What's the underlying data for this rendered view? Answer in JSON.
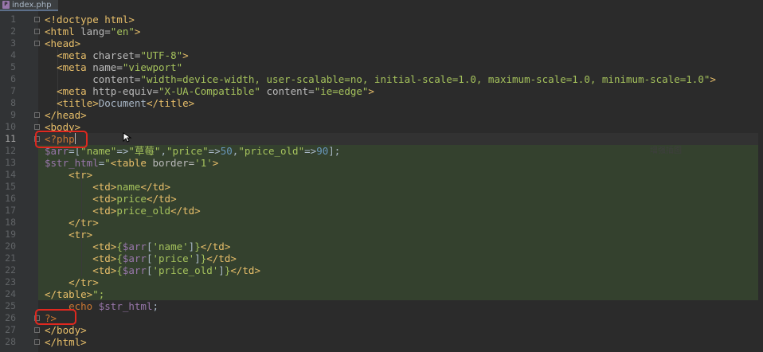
{
  "tab": {
    "file_icon": "php-file-icon",
    "title": "index.php"
  },
  "lines": [
    [
      [
        "tag",
        "<!doctype html>"
      ]
    ],
    [
      [
        "tag",
        "<html "
      ],
      [
        "attr",
        "lang="
      ],
      [
        "str",
        "\"en\""
      ],
      [
        "tag",
        ">"
      ]
    ],
    [
      [
        "tag",
        "<head>"
      ]
    ],
    [
      [
        "txt",
        "  "
      ],
      [
        "tag",
        "<meta "
      ],
      [
        "attr",
        "charset="
      ],
      [
        "str",
        "\"UTF-8\""
      ],
      [
        "tag",
        ">"
      ]
    ],
    [
      [
        "txt",
        "  "
      ],
      [
        "tag",
        "<meta "
      ],
      [
        "attr",
        "name="
      ],
      [
        "str",
        "\"viewport\""
      ]
    ],
    [
      [
        "txt",
        "        "
      ],
      [
        "attr",
        "content="
      ],
      [
        "str",
        "\"width=device-width, user-scalable=no, initial-scale=1.0, maximum-scale=1.0, minimum-scale=1.0\""
      ],
      [
        "tag",
        ">"
      ]
    ],
    [
      [
        "txt",
        "  "
      ],
      [
        "tag",
        "<meta "
      ],
      [
        "attr",
        "http-equiv="
      ],
      [
        "str",
        "\"X-UA-Compatible\""
      ],
      [
        "attr",
        " content="
      ],
      [
        "str",
        "\"ie=edge\""
      ],
      [
        "tag",
        ">"
      ]
    ],
    [
      [
        "txt",
        "  "
      ],
      [
        "tag",
        "<title>"
      ],
      [
        "txt",
        "Document"
      ],
      [
        "tag",
        "</title>"
      ]
    ],
    [
      [
        "tag",
        "</head>"
      ]
    ],
    [
      [
        "tag",
        "<body>"
      ]
    ],
    [
      [
        "kw",
        "<?php"
      ]
    ],
    [
      [
        "var",
        "$arr"
      ],
      [
        "txt",
        "=["
      ],
      [
        "str",
        "\"name\""
      ],
      [
        "txt",
        "=>"
      ],
      [
        "str",
        "\"草莓\""
      ],
      [
        "txt",
        ","
      ],
      [
        "str",
        "\"price\""
      ],
      [
        "txt",
        "=>"
      ],
      [
        "num",
        "50"
      ],
      [
        "txt",
        ","
      ],
      [
        "str",
        "\"price_old\""
      ],
      [
        "txt",
        "=>"
      ],
      [
        "num",
        "90"
      ],
      [
        "txt",
        "];"
      ]
    ],
    [
      [
        "var",
        "$str_html"
      ],
      [
        "txt",
        "="
      ],
      [
        "str",
        "\""
      ],
      [
        "tag",
        "<table "
      ],
      [
        "attr",
        "border="
      ],
      [
        "str",
        "'1'"
      ],
      [
        "tag",
        ">"
      ]
    ],
    [
      [
        "txt",
        "    "
      ],
      [
        "tag",
        "<tr>"
      ]
    ],
    [
      [
        "txt",
        "        "
      ],
      [
        "tag",
        "<td>"
      ],
      [
        "str",
        "name"
      ],
      [
        "tag",
        "</td>"
      ]
    ],
    [
      [
        "txt",
        "        "
      ],
      [
        "tag",
        "<td>"
      ],
      [
        "str",
        "price"
      ],
      [
        "tag",
        "</td>"
      ]
    ],
    [
      [
        "txt",
        "        "
      ],
      [
        "tag",
        "<td>"
      ],
      [
        "str",
        "price_old"
      ],
      [
        "tag",
        "</td>"
      ]
    ],
    [
      [
        "txt",
        "    "
      ],
      [
        "tag",
        "</tr>"
      ]
    ],
    [
      [
        "txt",
        "    "
      ],
      [
        "tag",
        "<tr>"
      ]
    ],
    [
      [
        "txt",
        "        "
      ],
      [
        "tag",
        "<td>"
      ],
      [
        "str",
        "{"
      ],
      [
        "var",
        "$arr"
      ],
      [
        "txt",
        "["
      ],
      [
        "str",
        "'name'"
      ],
      [
        "txt",
        "]"
      ],
      [
        "str",
        "}"
      ],
      [
        "tag",
        "</td>"
      ]
    ],
    [
      [
        "txt",
        "        "
      ],
      [
        "tag",
        "<td>"
      ],
      [
        "str",
        "{"
      ],
      [
        "var",
        "$arr"
      ],
      [
        "txt",
        "["
      ],
      [
        "str",
        "'price'"
      ],
      [
        "txt",
        "]"
      ],
      [
        "str",
        "}"
      ],
      [
        "tag",
        "</td>"
      ]
    ],
    [
      [
        "txt",
        "        "
      ],
      [
        "tag",
        "<td>"
      ],
      [
        "str",
        "{"
      ],
      [
        "var",
        "$arr"
      ],
      [
        "txt",
        "["
      ],
      [
        "str",
        "'price_old'"
      ],
      [
        "txt",
        "]"
      ],
      [
        "str",
        "}"
      ],
      [
        "tag",
        "</td>"
      ]
    ],
    [
      [
        "txt",
        "    "
      ],
      [
        "tag",
        "</tr>"
      ]
    ],
    [
      [
        "tag",
        "</table>"
      ],
      [
        "str",
        "\";"
      ]
    ],
    [
      [
        "txt",
        "    "
      ],
      [
        "kw",
        "echo "
      ],
      [
        "var",
        "$str_html"
      ],
      [
        "txt",
        ";"
      ]
    ],
    [
      [
        "kw",
        "?>"
      ]
    ],
    [
      [
        "tag",
        "</body>"
      ]
    ],
    [
      [
        "tag",
        "</html>"
      ]
    ]
  ],
  "current_line": 11,
  "highlighted_lines": [
    12,
    24
  ],
  "watermark": "增强插图",
  "colors": {
    "accent": "#e0281f",
    "background": "#2b2b2b",
    "gutter": "#313335"
  }
}
